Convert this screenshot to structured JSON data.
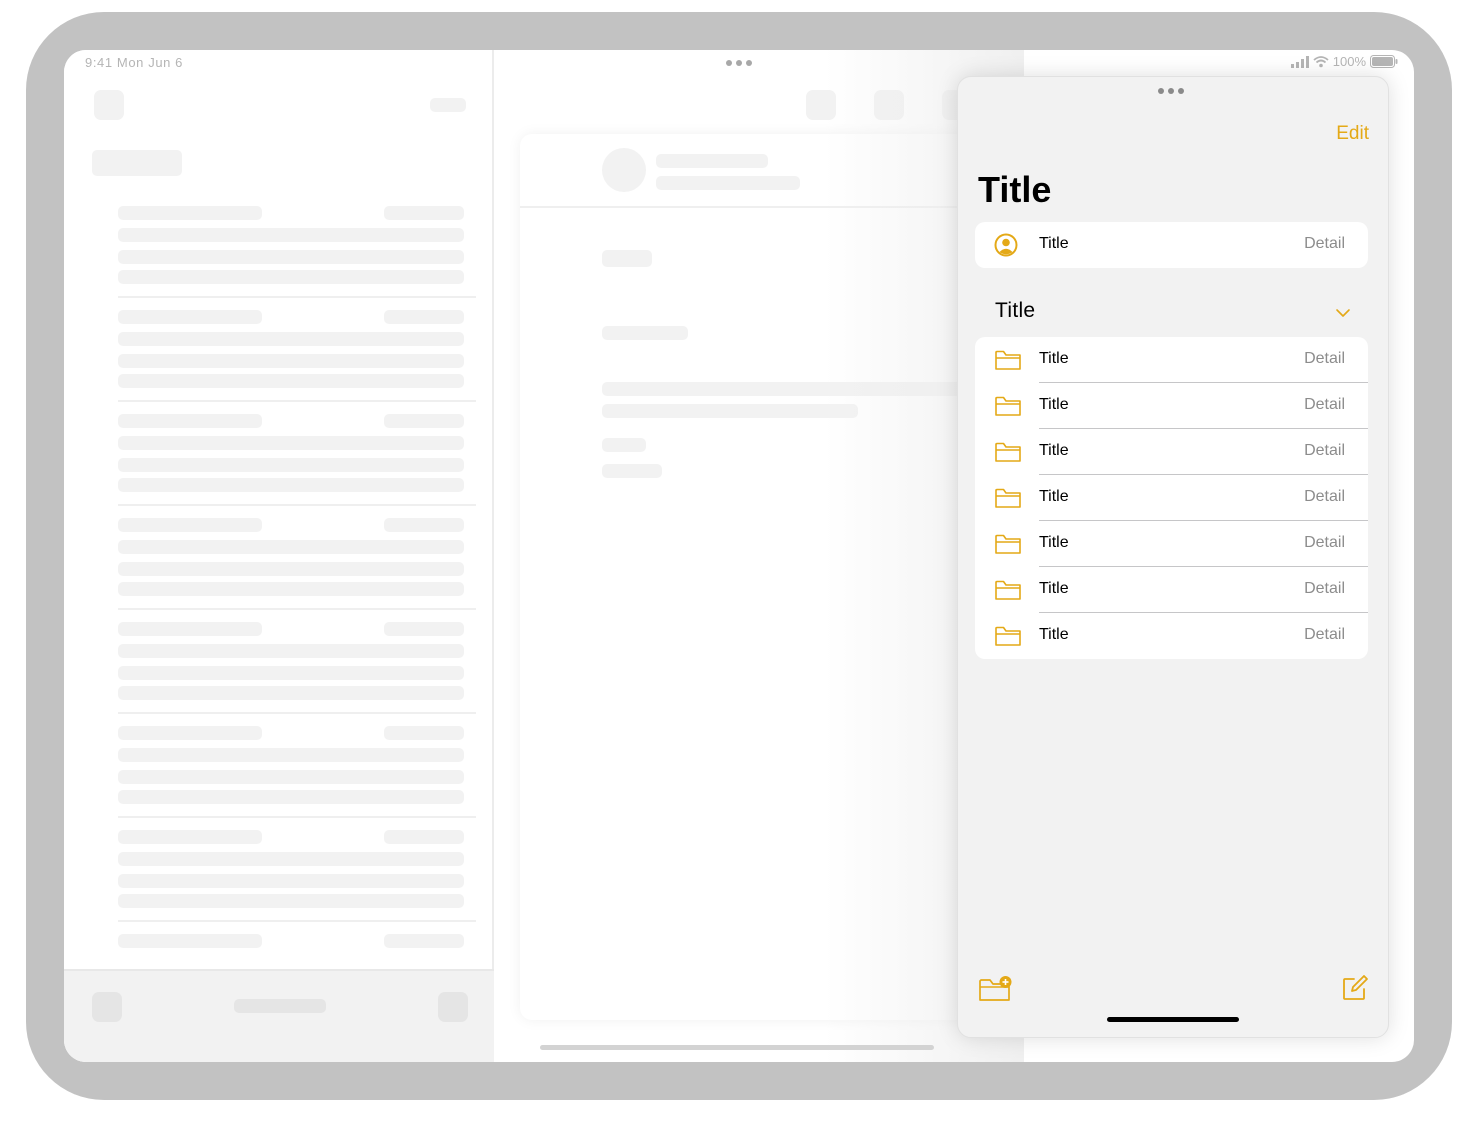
{
  "status_bar": {
    "time": "9:41 Mon Jun 6",
    "battery": "100%"
  },
  "panel": {
    "edit_label": "Edit",
    "title": "Title",
    "account_row": {
      "title": "Title",
      "detail": "Detail",
      "icon": "person-crop-circle-icon"
    },
    "section": {
      "title": "Title",
      "rows": [
        {
          "title": "Title",
          "detail": "Detail",
          "icon": "folder-icon"
        },
        {
          "title": "Title",
          "detail": "Detail",
          "icon": "folder-icon"
        },
        {
          "title": "Title",
          "detail": "Detail",
          "icon": "folder-icon"
        },
        {
          "title": "Title",
          "detail": "Detail",
          "icon": "folder-icon"
        },
        {
          "title": "Title",
          "detail": "Detail",
          "icon": "folder-icon"
        },
        {
          "title": "Title",
          "detail": "Detail",
          "icon": "folder-icon"
        },
        {
          "title": "Title",
          "detail": "Detail",
          "icon": "folder-icon"
        }
      ]
    },
    "toolbar": {
      "new_folder_icon": "folder-badge-plus-icon",
      "compose_icon": "square-and-pencil-icon"
    }
  },
  "colors": {
    "accent": "#e4a917",
    "panel_background": "#f2f2f2",
    "device_frame": "#c2c2c2"
  }
}
